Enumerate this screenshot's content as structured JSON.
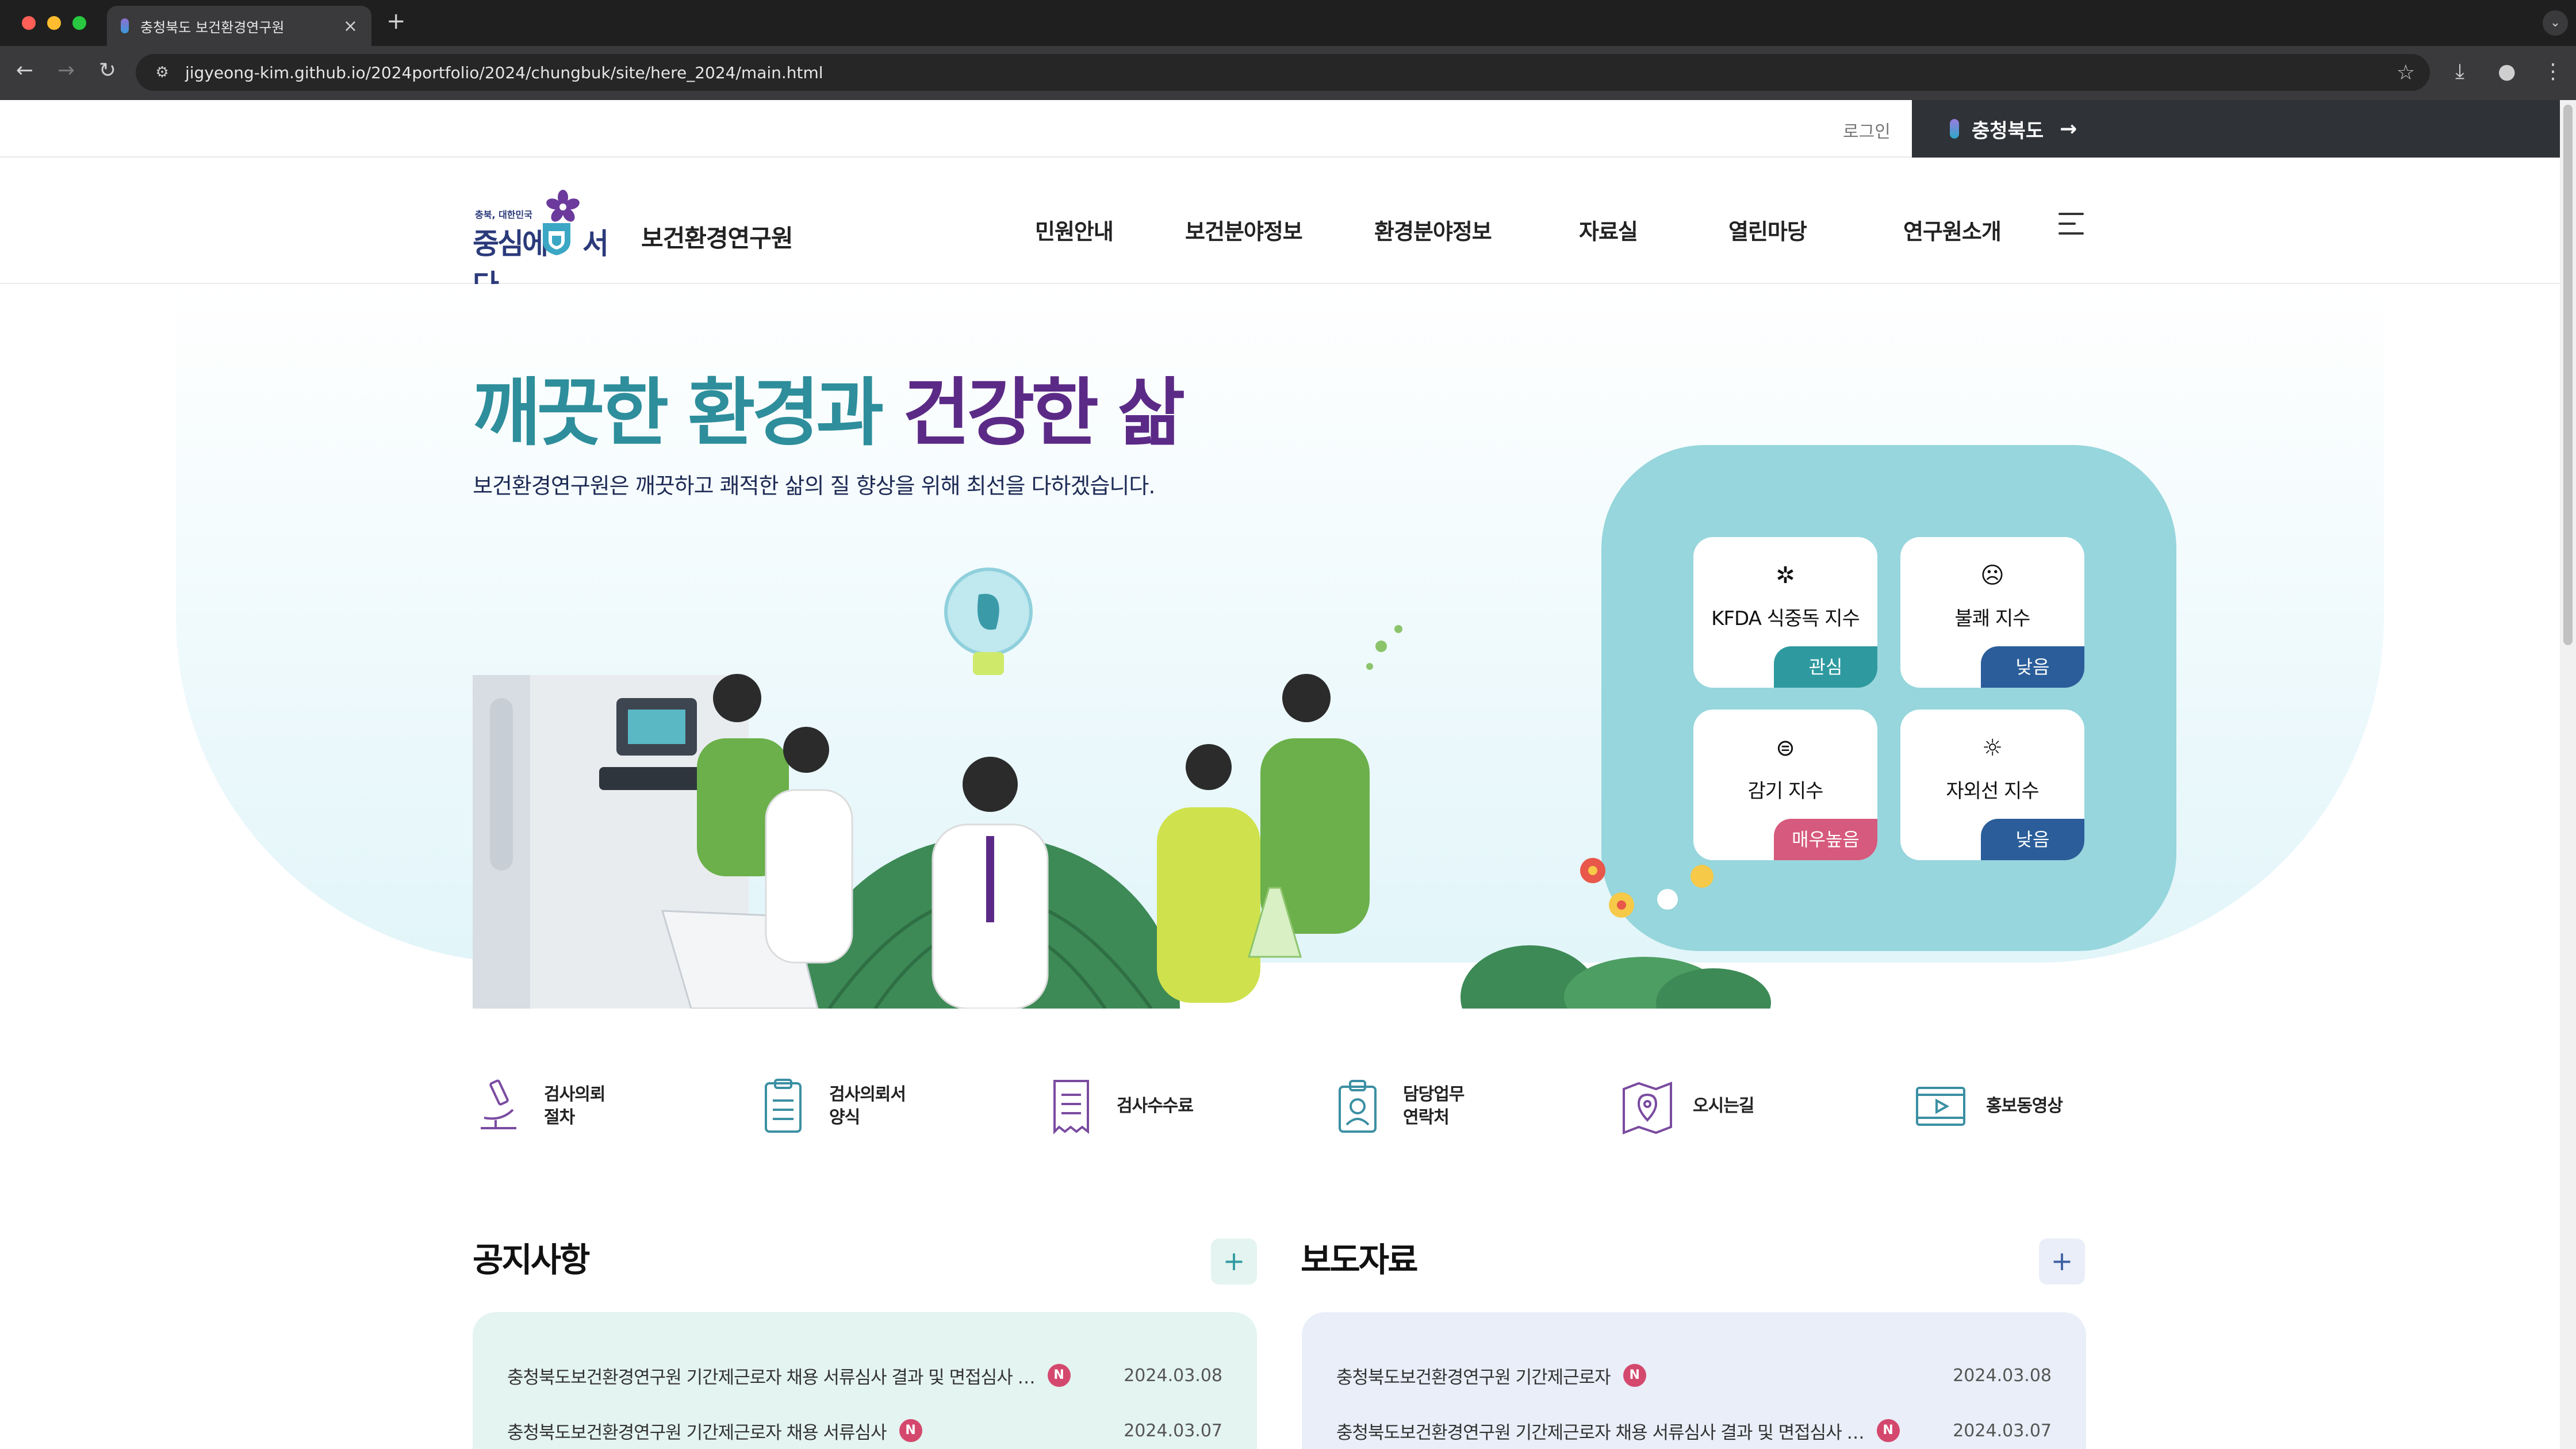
{
  "browser": {
    "tab_title": "충청북도 보건환경연구원",
    "tab_close": "×",
    "new_tab": "+",
    "url": "jigyeong-kim.github.io/2024portfolio/2024/chungbuk/site/here_2024/main.html",
    "icons": [
      "back-icon",
      "forward-icon",
      "reload-icon",
      "site-info-icon",
      "bookmark-star-icon",
      "download-icon",
      "profile-icon",
      "kebab-menu-icon",
      "tab-search-icon"
    ]
  },
  "utility": {
    "login": "로그인",
    "province_button": "충청북도",
    "province_arrow": "→"
  },
  "logo": {
    "small": "충북, 대한민국",
    "slogan_left": "중심에",
    "slogan_right": "서다",
    "org_name": "보건환경연구원"
  },
  "nav": {
    "items": [
      "민원안내",
      "보건분야정보",
      "환경분야정보",
      "자료실",
      "열린마당",
      "연구원소개"
    ]
  },
  "hero": {
    "title_part1": "깨끗한 환경과 ",
    "title_part2": "건강한 삶",
    "subtitle": "보건환경연구원은 깨끗하고 쾌적한 삶의 질 향상을 위해 최선을 다하겠습니다."
  },
  "indices": [
    {
      "icon": "virus-icon",
      "label": "KFDA 식중독 지수",
      "status": "관심",
      "color": "#2e9aa0"
    },
    {
      "icon": "discomfort-face-icon",
      "label": "불쾌 지수",
      "status": "낮음",
      "color": "#2a5d99"
    },
    {
      "icon": "cold-mask-icon",
      "label": "감기 지수",
      "status": "매우높음",
      "color": "#d65a7d"
    },
    {
      "icon": "uv-sun-icon",
      "label": "자외선 지수",
      "status": "낮음",
      "color": "#2a5d99"
    }
  ],
  "quick_links": [
    {
      "icon": "microscope-icon",
      "label": "검사의뢰\n절차"
    },
    {
      "icon": "clipboard-icon",
      "label": "검사의뢰서\n양식"
    },
    {
      "icon": "receipt-icon",
      "label": "검사수수료"
    },
    {
      "icon": "contact-badge-icon",
      "label": "담당업무\n연락처"
    },
    {
      "icon": "map-pin-icon",
      "label": "오시는길"
    },
    {
      "icon": "video-film-icon",
      "label": "홍보동영상"
    }
  ],
  "notice": {
    "title": "공지사항",
    "plus": "+",
    "bg": "#e4f4f0",
    "plus_color": "#2e9aa0",
    "items": [
      {
        "text": "충청북도보건환경연구원 기간제근로자 채용 서류심사 결과 및 면접심사 …",
        "badge": "N",
        "date": "2024.03.08"
      },
      {
        "text": "충청북도보건환경연구원 기간제근로자 채용 서류심사",
        "badge": "N",
        "date": "2024.03.07"
      }
    ]
  },
  "press": {
    "title": "보도자료",
    "plus": "+",
    "bg": "#e9eef8",
    "plus_color": "#3d5fa3",
    "items": [
      {
        "text": "충청북도보건환경연구원 기간제근로자",
        "badge": "N",
        "date": "2024.03.08"
      },
      {
        "text": "충청북도보건환경연구원 기간제근로자 채용 서류심사 결과 및 면접심사 …",
        "badge": "N",
        "date": "2024.03.07"
      }
    ]
  },
  "colors": {
    "teal": "#2e8e9b",
    "purple": "#5b2a86",
    "widget_bg": "#96d6dc",
    "new_badge": "#d4486e"
  }
}
